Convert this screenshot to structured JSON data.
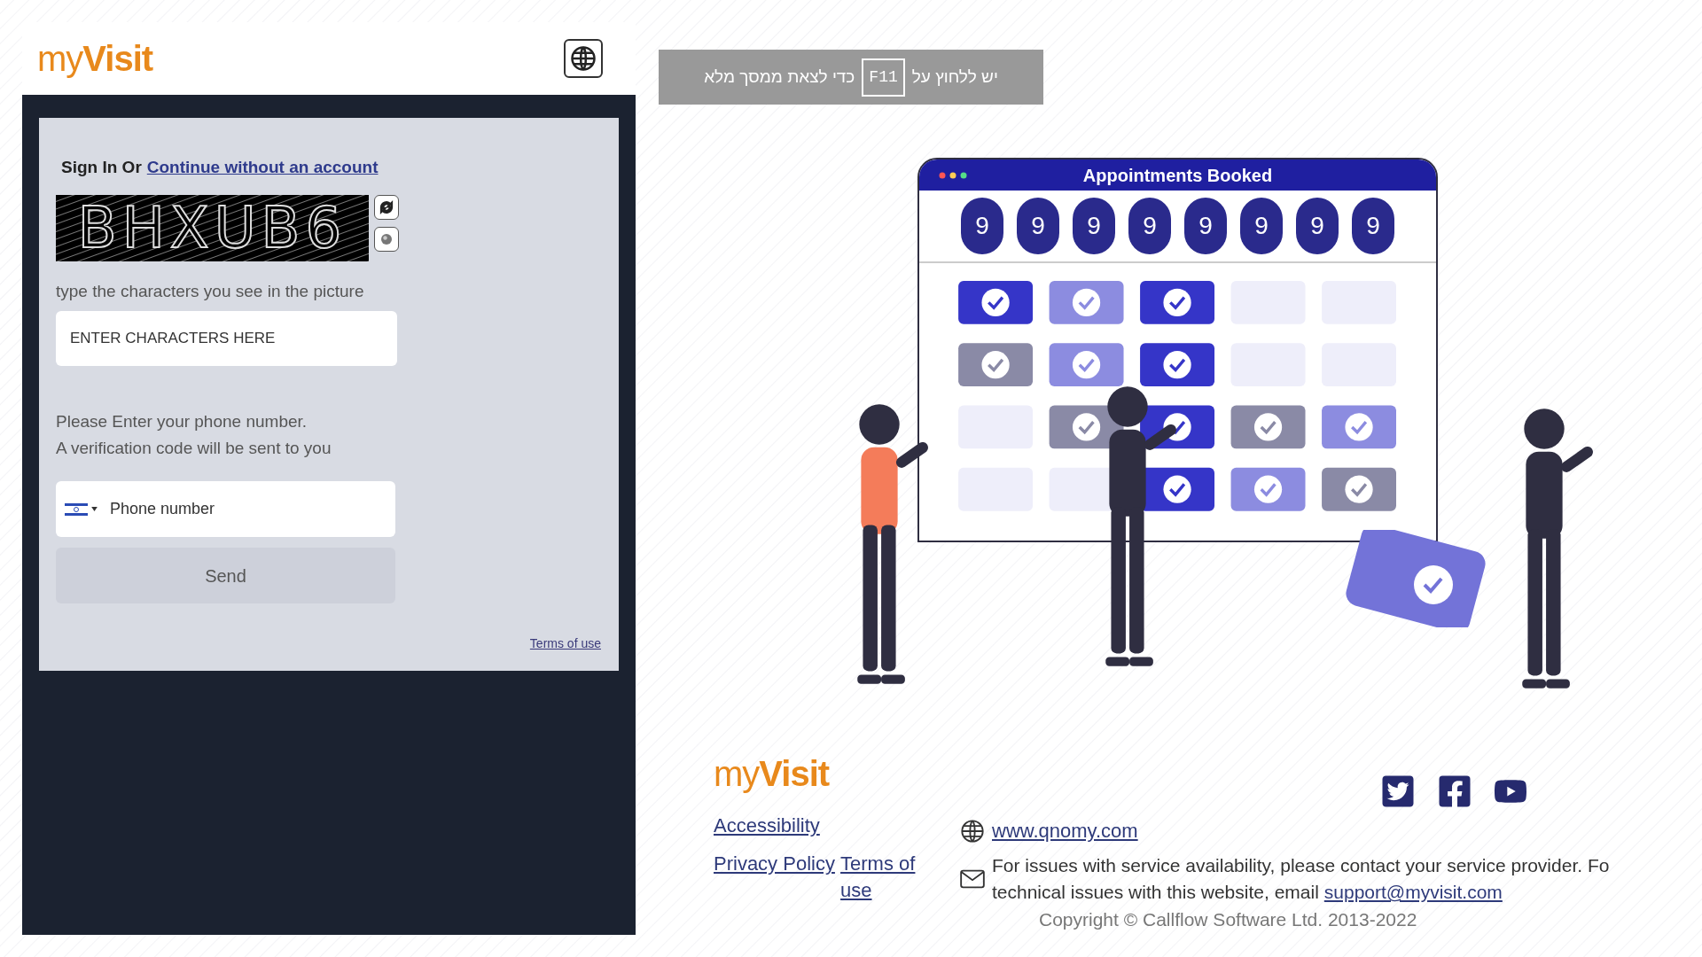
{
  "header": {
    "logo": {
      "light": "my",
      "bold": "Visit"
    }
  },
  "signin": {
    "prefix": "Sign In Or",
    "link": "Continue without an account"
  },
  "captcha": {
    "image_text": "BHXUB6",
    "hint": "type the characters you see in the picture",
    "input": {
      "placeholder": "ENTER CHARACTERS HERE"
    }
  },
  "phone": {
    "instructions": [
      "Please Enter your phone number.",
      "A verification code will be sent to you"
    ],
    "input": {
      "placeholder": "Phone number"
    },
    "send_button": "Send",
    "terms_link": "Terms of use"
  },
  "fullscreen_notice": {
    "before": "יש ללחוץ על",
    "key": "F11",
    "after": "כדי לצאת ממסך מלא"
  },
  "illustration": {
    "title": "Appointments Booked",
    "digits": [
      "9",
      "9",
      "9",
      "9",
      "9",
      "9",
      "9",
      "9"
    ]
  },
  "footer": {
    "logo": {
      "light": "my",
      "bold": "Visit"
    },
    "links": [
      "Accessibility",
      "Privacy Policy",
      "Terms of use"
    ],
    "website": "www.qnomy.com",
    "contact": {
      "line_1": "For issues with service availability, please contact your service provider. Fo",
      "line_2": "technical issues with this website, email",
      "email": "support@myvisit.com"
    },
    "copyright": "Copyright © Callflow Software Ltd. 2013-2022"
  }
}
